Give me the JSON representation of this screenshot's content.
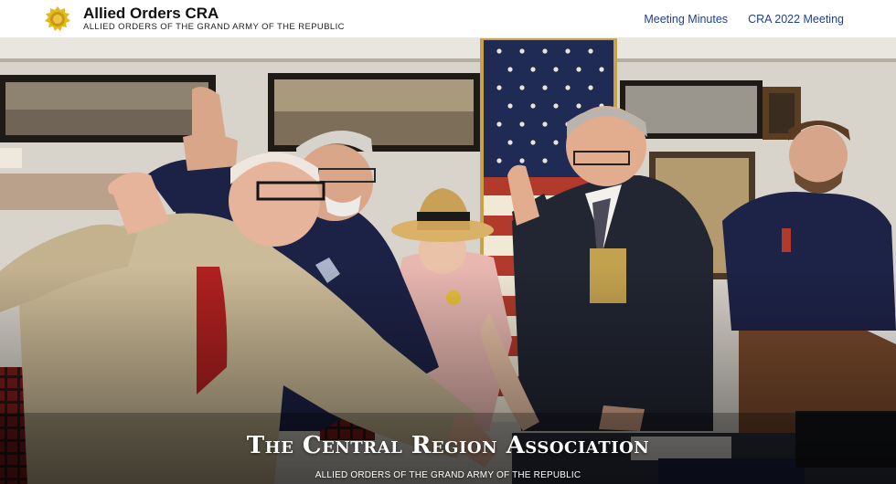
{
  "header": {
    "brand_title": "Allied Orders CRA",
    "brand_tagline": "ALLIED ORDERS OF THE GRAND ARMY OF THE REPUBLIC",
    "logo_icon": "gold-seal-icon",
    "nav": [
      {
        "label": "Meeting Minutes"
      },
      {
        "label": "CRA 2022 Meeting"
      }
    ],
    "link_color": "#1f3f8f"
  },
  "hero": {
    "title": "The Central Region Association",
    "subtitle": "ALLIED ORDERS OF THE GRAND ARMY OF THE REPUBLIC",
    "photo_description_icon": "group-salute-photo"
  }
}
